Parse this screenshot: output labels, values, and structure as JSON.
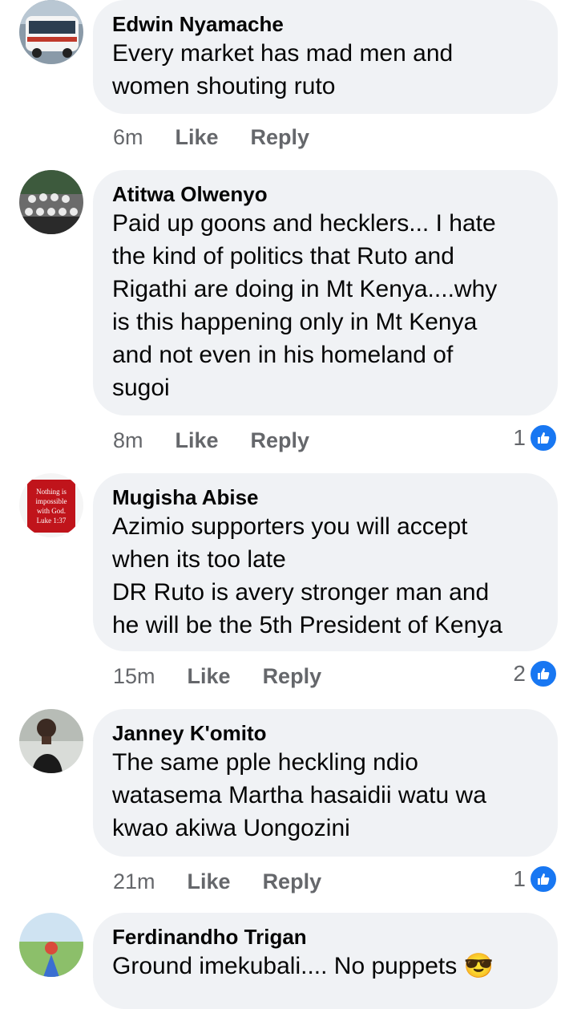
{
  "comments": [
    {
      "name": "Edwin Nyamache",
      "text": "Every market has mad men and\nwomen shouting ruto",
      "time": "6m",
      "like": "Like",
      "reply": "Reply",
      "reactions": "",
      "avatar_icon": "bus-photo-avatar"
    },
    {
      "name": "Atitwa Olwenyo",
      "text": "Paid up goons and hecklers... I hate\nthe kind of politics that Ruto and\nRigathi are doing in Mt Kenya....why\nis this happening only in Mt Kenya\nand not even in his homeland of\nsugoi",
      "time": "8m",
      "like": "Like",
      "reply": "Reply",
      "reactions": "1",
      "avatar_icon": "team-photo-avatar"
    },
    {
      "name": "Mugisha Abise",
      "text": "Azimio supporters you will accept\nwhen its too late\nDR  Ruto is avery stronger man and\nhe will be the 5th President of Kenya",
      "time": "15m",
      "like": "Like",
      "reply": "Reply",
      "reactions": "2",
      "avatar_icon": "verse-mug-avatar",
      "avatar_text": [
        "Nothing is",
        "impossible",
        "with God.",
        "Luke 1:37"
      ]
    },
    {
      "name": "Janney K'omito",
      "text": "The same pple heckling ndio\nwatasema Martha hasaidii watu wa\nkwao akiwa Uongozini",
      "time": "21m",
      "like": "Like",
      "reply": "Reply",
      "reactions": "1",
      "avatar_icon": "person-photo-avatar"
    },
    {
      "name": "Ferdinandho Trigan",
      "text": "Ground imekubali.... No puppets 😎",
      "avatar_icon": "outdoor-photo-avatar"
    }
  ],
  "colors": {
    "bubble": "#f0f2f5",
    "like_blue": "#1877f2",
    "meta": "#65676b"
  }
}
